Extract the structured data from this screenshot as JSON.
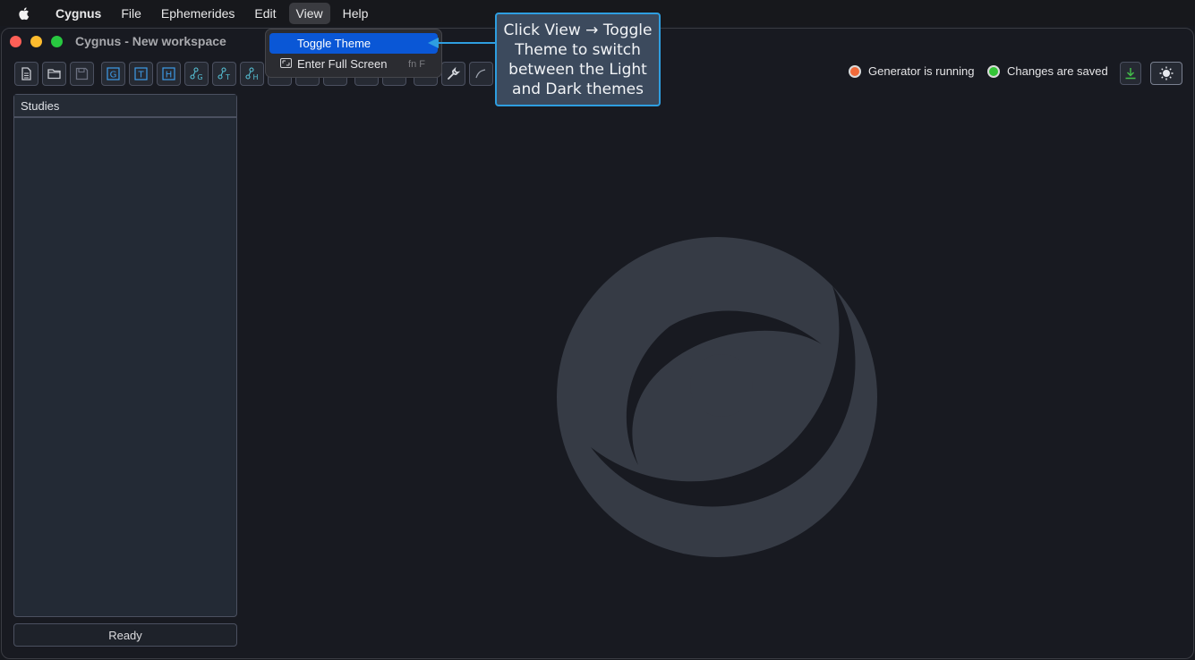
{
  "menubar": {
    "app_name": "Cygnus",
    "items": [
      "File",
      "Ephemerides",
      "Edit",
      "View",
      "Help"
    ]
  },
  "window": {
    "title": "Cygnus - New workspace"
  },
  "toolbar": {
    "letter_buttons": [
      "G",
      "T",
      "H"
    ],
    "graph_buttons": [
      "G",
      "T",
      "H"
    ]
  },
  "status": {
    "generator": "Generator is running",
    "changes": "Changes are saved"
  },
  "studies": {
    "header": "Studies"
  },
  "statusbar": {
    "text": "Ready"
  },
  "view_menu": {
    "items": [
      {
        "label": "Toggle Theme",
        "shortcut": ""
      },
      {
        "label": "Enter Full Screen",
        "shortcut": "fn F"
      }
    ]
  },
  "callout": {
    "text": "Click View → Toggle Theme to switch between the Light and Dark themes"
  },
  "colors": {
    "accent": "#0a57d6",
    "callout_border": "#2e9ee0",
    "status_running": "#f06a3a",
    "status_saved": "#34c437"
  }
}
